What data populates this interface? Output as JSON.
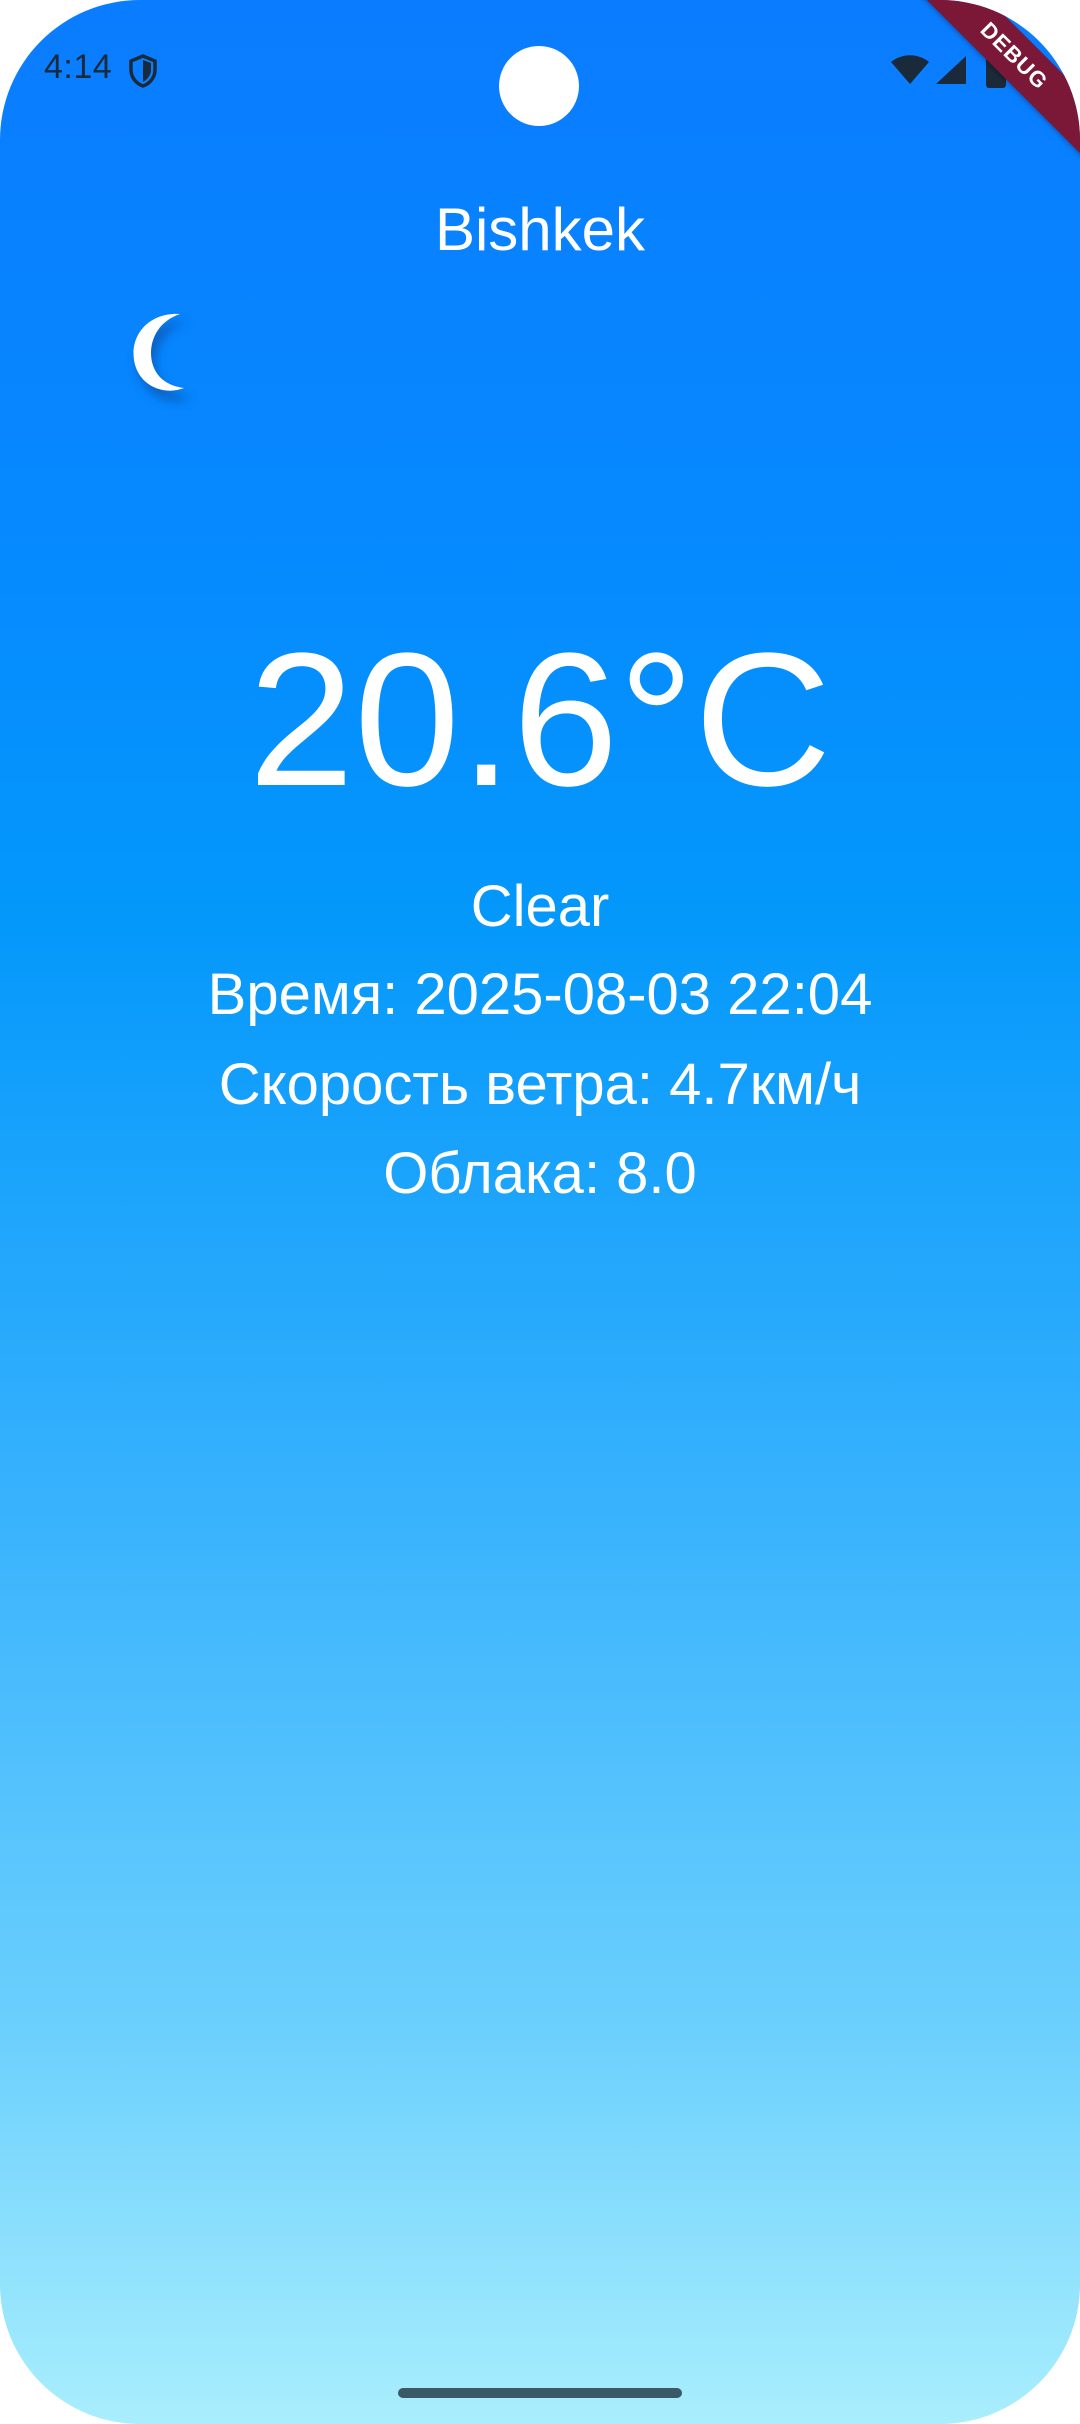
{
  "status_bar": {
    "time": "4:14",
    "icons": [
      "shield-icon",
      "wifi-icon",
      "signal-icon",
      "battery-icon"
    ],
    "debug_label": "DEBUG"
  },
  "weather": {
    "city": "Bishkek",
    "icon": "moon-icon",
    "temperature": "20.6°C",
    "condition": "Clear",
    "time_line": "Время: 2025-08-03 22:04",
    "wind_line": "Скорость ветра: 4.7км/ч",
    "clouds_line": "Облака: 8.0"
  },
  "colors": {
    "gradient_top": "#0a7cff",
    "gradient_bottom": "#a9eefd",
    "text": "#ffffff",
    "debug_banner": "#7b1737"
  }
}
